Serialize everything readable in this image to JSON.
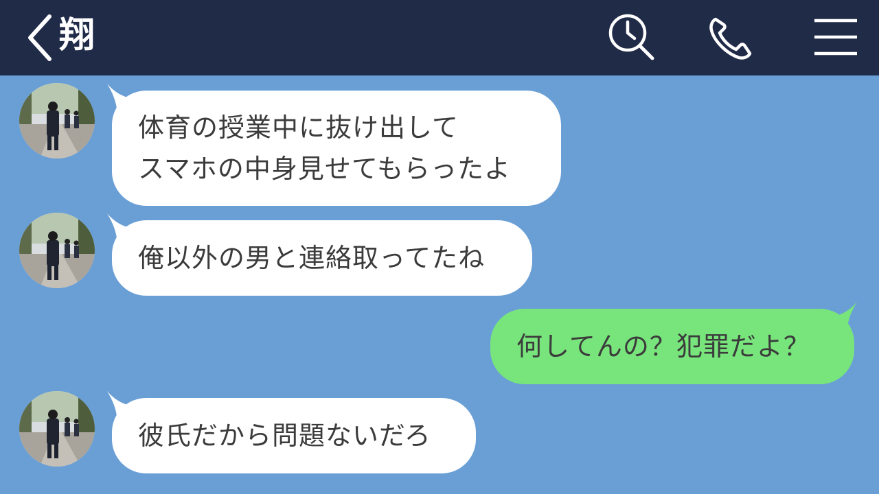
{
  "header": {
    "contact_name": "翔",
    "icons": [
      "back-icon",
      "search-history-icon",
      "phone-icon",
      "menu-icon"
    ]
  },
  "messages": [
    {
      "direction": "incoming",
      "lines": [
        "体育の授業中に抜け出して",
        "スマホの中身見せてもらったよ"
      ]
    },
    {
      "direction": "incoming",
      "lines": [
        "俺以外の男と連絡取ってたね"
      ]
    },
    {
      "direction": "outgoing",
      "lines": [
        "何してんの？犯罪だよ？"
      ]
    },
    {
      "direction": "incoming",
      "lines": [
        "彼氏だから問題ないだろ"
      ]
    }
  ],
  "colors": {
    "header_bg": "#202b48",
    "chat_bg": "#6a9fd6",
    "incoming_bubble": "#ffffff",
    "outgoing_bubble": "#78e57c"
  }
}
